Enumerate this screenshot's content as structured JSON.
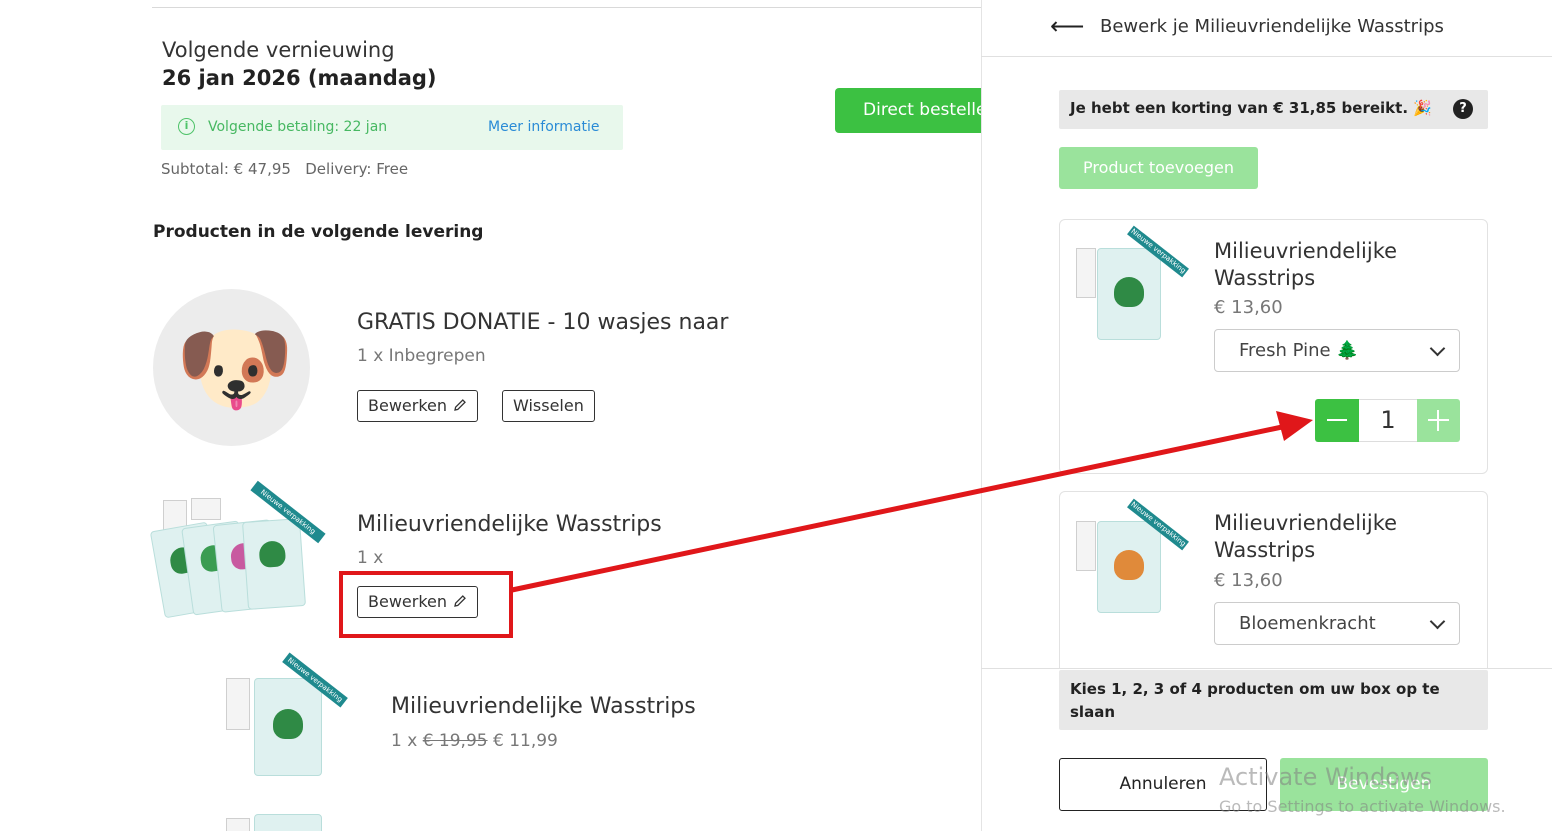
{
  "renewal": {
    "label": "Volgende vernieuwing",
    "date": "26 jan 2026 (maandag)",
    "payment_info": "Volgende betaling: 22 jan",
    "more_info_link": "Meer informatie",
    "subtotal": "Subtotal: € 47,95",
    "delivery": "Delivery: Free",
    "order_now_button": "Direct bestellen"
  },
  "products_section": {
    "title": "Producten in de volgende levering",
    "items": [
      {
        "title": "GRATIS DONATIE - 10 wasjes naar",
        "subtitle": "1 x Inbegrepen",
        "edit_label": "Bewerken",
        "swap_label": "Wisselen",
        "avatar_emoji": "🐶"
      },
      {
        "title": "Milieuvriendelijke Wasstrips",
        "subtitle": "1 x",
        "edit_label": "Bewerken",
        "ribbon": "Nieuwe verpakking"
      },
      {
        "title": "Milieuvriendelijke Wasstrips",
        "qty_prefix": "1 x",
        "old_price": "€ 19,95",
        "new_price": "€ 11,99",
        "ribbon": "Nieuwe verpakking"
      }
    ]
  },
  "edit_panel": {
    "title": "Bewerk je Milieuvriendelijke Wasstrips",
    "discount_message": "Je hebt een korting van € 31,85 bereikt. 🎉",
    "help_label": "?",
    "add_product_button": "Product toevoegen",
    "cards": [
      {
        "title": "Milieuvriendelijke Wasstrips",
        "price": "€ 13,60",
        "variant": "Fresh Pine 🌲",
        "quantity": "1",
        "ribbon": "Nieuwe verpakking"
      },
      {
        "title": "Milieuvriendelijke Wasstrips",
        "price": "€ 13,60",
        "variant": "Bloemenkracht",
        "ribbon": "Nieuwe verpakking"
      }
    ],
    "footer_message": "Kies 1, 2, 3 of 4 producten om uw box op te slaan",
    "cancel_button": "Annuleren",
    "confirm_button": "Bevestigen"
  },
  "watermark": {
    "line1": "Activate Windows",
    "line2": "Go to Settings to activate Windows."
  },
  "colors": {
    "primary_green": "#3cc142",
    "disabled_green": "#9ae39c",
    "annotation_red": "#e0171a",
    "link_blue": "#2a8bd6"
  }
}
